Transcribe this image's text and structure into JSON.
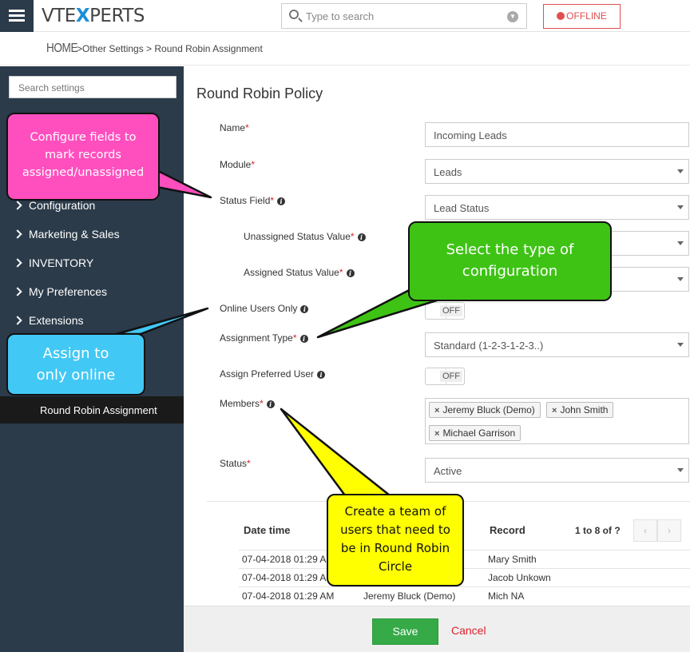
{
  "header": {
    "logo": {
      "part1": "VTE",
      "part2": "X",
      "part3": "PERTS"
    },
    "search_placeholder": "Type to search",
    "offline_label": "OFFLINE"
  },
  "breadcrumb": {
    "home": "HOME",
    "rest": ">Other Settings >  Round Robin Assignment"
  },
  "sidebar": {
    "search_placeholder": "Search settings",
    "items": [
      "Configuration",
      "Marketing & Sales",
      "INVENTORY",
      "My Preferences",
      "Extensions"
    ],
    "active_item": "Round Robin Assignment"
  },
  "form": {
    "title": "Round Robin Policy",
    "name_label": "Name",
    "name_value": "Incoming Leads",
    "module_label": "Module",
    "module_value": "Leads",
    "status_field_label": "Status Field",
    "status_field_value": "Lead Status",
    "unassigned_label": "Unassigned Status Value",
    "assigned_label": "Assigned Status Value",
    "online_label": "Online Users Only",
    "online_toggle": "OFF",
    "assignment_type_label": "Assignment Type",
    "assignment_type_value": "Standard (1-2-3-1-2-3..)",
    "preferred_label": "Assign Preferred User",
    "preferred_toggle": "OFF",
    "members_label": "Members",
    "members": [
      "Jeremy Bluck (Demo)",
      "John Smith",
      "Michael Garrison"
    ],
    "status_label": "Status",
    "status_value": "Active",
    "required_mark": "*",
    "info_glyph": "i"
  },
  "history": {
    "col_datetime": "Date time",
    "col_record": "Record",
    "pager": "1 to 8  of ?",
    "rows": [
      {
        "datetime": "07-04-2018 01:29 A",
        "user": "",
        "record": "Mary Smith"
      },
      {
        "datetime": "07-04-2018 01:29 A",
        "user": "",
        "record": "Jacob Unkown"
      },
      {
        "datetime": "07-04-2018 01:29 AM",
        "user": "Jeremy Bluck (Demo)",
        "record": "Mich NA"
      }
    ]
  },
  "footer": {
    "save_label": "Save",
    "cancel_label": "Cancel"
  },
  "callouts": {
    "pink": [
      "Configure fields to",
      "mark records",
      "assigned/unassigned"
    ],
    "blue": [
      "Assign to",
      "only online"
    ],
    "green": [
      "Select the type of",
      "configuration"
    ],
    "yellow": [
      "Create a team of",
      "users that need to",
      "be in Round Robin",
      "Circle"
    ]
  },
  "colors": {
    "sidebar": "#2b3b4a",
    "accent_blue": "#1c8fd6",
    "required_red": "#d9232d",
    "save_green": "#35aa47",
    "callout_pink": "#ff4fbe",
    "callout_blue": "#42c8f5",
    "callout_green": "#3ec315",
    "callout_yellow": "#ffff00"
  }
}
